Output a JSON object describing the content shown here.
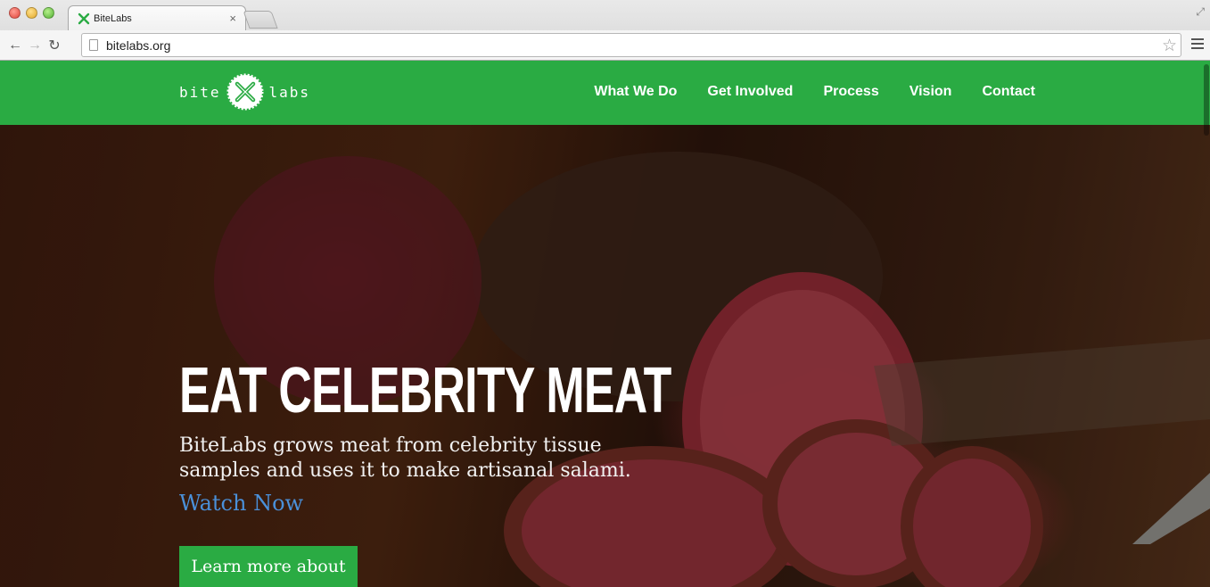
{
  "browser": {
    "tab_title": "BiteLabs",
    "tab_close": "×",
    "url": "bitelabs.org",
    "icons": {
      "back": "back-arrow-icon",
      "forward": "forward-arrow-icon",
      "reload": "reload-icon",
      "star": "star-icon",
      "menu": "menu-icon",
      "fullscreen": "fullscreen-icon"
    },
    "glyphs": {
      "back": "←",
      "forward": "→",
      "reload": "↻",
      "star": "☆",
      "fullscreen": "⤢"
    }
  },
  "site": {
    "logo_left": "bite",
    "logo_right": "labs",
    "nav": [
      "What We Do",
      "Get Involved",
      "Process",
      "Vision",
      "Contact"
    ],
    "brand_color": "#2aab43"
  },
  "hero": {
    "headline": "EAT CELEBRITY MEAT",
    "subheadline": "BiteLabs grows meat from celebrity tissue samples and uses it to make artisanal salami.",
    "watch_link": "Watch Now",
    "cta_button": "Learn more about us",
    "link_color": "#4a90d9"
  }
}
